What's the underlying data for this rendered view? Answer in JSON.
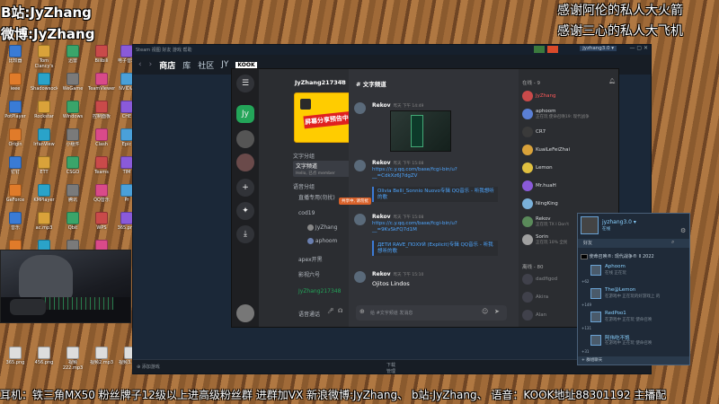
{
  "overlay": {
    "bilibili": "B站:JyZhang",
    "weibo": "微博:JyZhang",
    "thanks_1": "感谢阿伦的私人大火箭",
    "thanks_2": "感谢三心的私人大飞机",
    "ticker": "耳机：铁三角MX50 粉丝牌子12级以上进高级粉丝群 进群加VX   新浪微博:JyZhang、 b站:JyZhang、  语音：KOOK地址88301192  主播配"
  },
  "desktop_icons": [
    "比较器",
    "Tom Clancy's Rainbow",
    "迅雷",
    "Bilibili",
    "电子音乐",
    "ieee",
    "Shadowsocks",
    "WeGame",
    "TeamViewer",
    "NVIDIA",
    "PotPlayer",
    "Rockstar",
    "Windows",
    "控制面板",
    "CHE",
    "Origin",
    "IrfanView",
    "小组件",
    "Clash",
    "Epic",
    "钉钉",
    "ETT",
    "CSGO",
    "Teams",
    "TIM",
    "GeForce",
    "KMPlayer",
    "腾讯",
    "QQ音乐",
    "Pr",
    "音乐",
    "ac.mp3",
    "Qbit",
    "WPS",
    "365.png",
    "456.png",
    "视频 222.mp3",
    "视频2.mp3",
    "视频3.mp3"
  ],
  "steam": {
    "nav": [
      "商店",
      "库",
      "社区",
      "JY",
      "KOOK"
    ],
    "account": "jyzhang3.0 ▾",
    "add_game": "添加游戏",
    "downloads": "下载",
    "manage": "管理"
  },
  "kook": {
    "server_title": "JyZhang217348",
    "banner_text": "屏幕分享预告中!",
    "section_text": "文字分组",
    "channel_text": "文字频道",
    "channel_sub": "Hello, 已点 member",
    "section_voice": "语音分组",
    "voice_channels": [
      "直播专用(勿扰)",
      "cod19",
      "apex开黑",
      "影视六号"
    ],
    "voice_users": [
      "JyZhang",
      "aphoom"
    ],
    "user_badge": "JyZhang217348",
    "bottom_label": "语音通话",
    "chat_title": "文字频道",
    "messages": [
      {
        "author": "Rekov",
        "time": "昨天 下午 14:49",
        "kind": "image"
      },
      {
        "author": "Rekov",
        "time": "昨天 下午 15:08",
        "link": "https://c.y.qq.com/base/fcgi-bin/u?__=CdkXz6J7dgZV",
        "card_title": "Olivia Belli_Sonnio Nuovo专辑 QQ音乐 - 听我想听的歌"
      },
      {
        "author": "Rekov",
        "time": "昨天 下午 15:08",
        "link": "https://c.y.qq.com/base/fcgi-bin/u?__=9KvSkFQ7d1M",
        "card_title": "ДЕТИ RAVE_ПОХУЙ (Explicit)专辑 QQ音乐 - 听我想听的歌"
      },
      {
        "author": "Rekov",
        "time": "昨天 下午 15:10",
        "text": "Ojitos Lindos"
      }
    ],
    "input_placeholder": "给 #文字频道 发消息",
    "floating_tag": "共享中, 请勿扰",
    "members_online": "在线 - 9",
    "members_offline": "离线 - 80",
    "members": [
      {
        "name": "JyZhang",
        "sub": ""
      },
      {
        "name": "aphoom",
        "sub": "正在玩 使命召唤19: 现代战争"
      },
      {
        "name": "CR7",
        "sub": ""
      },
      {
        "name": "KuaiLeFeiZhai",
        "sub": ""
      },
      {
        "name": "Lemon",
        "sub": ""
      },
      {
        "name": "Mr.huaH",
        "sub": ""
      },
      {
        "name": "NingKing",
        "sub": ""
      },
      {
        "name": "Rekov",
        "sub": "正在玩 TX I Don't"
      },
      {
        "name": "Sorin",
        "sub": "正在玩 10% 全民"
      }
    ],
    "offline_members": [
      "dadfigod",
      "Akira",
      "Alan"
    ]
  },
  "friends": {
    "user": "jyzhang3.0 ▾",
    "status": "在线",
    "search_label": "好友",
    "game_line": "使命召唤®: 现代战争® II 2022",
    "rows": [
      {
        "name": "Aphoom",
        "sub": "在线 正在玩",
        "tag": "+62"
      },
      {
        "name": "The@Lemon",
        "sub": "在游戏中 正在玩的好游戏上 的",
        "tag": "+149"
      },
      {
        "name": "RedPoo1",
        "sub": "在游戏中 正在玩 使命召唤",
        "tag": "+131"
      },
      {
        "name": "阿伟吃不饱",
        "sub": "在游戏中 正在玩 使命召唤",
        "tag": "+31"
      }
    ],
    "bottom_label": "+ 群组聊天"
  },
  "colors": {
    "steam_bg": "#1b2838",
    "kook_bg": "#313338",
    "kook_green": "#23a559",
    "link_blue": "#4ea6ff",
    "banner_yellow": "#ffcc00",
    "banner_red": "#e02020"
  }
}
